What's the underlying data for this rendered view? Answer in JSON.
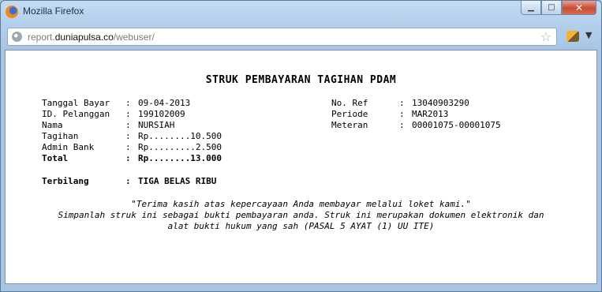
{
  "window": {
    "title": "Mozilla Firefox",
    "url_prefix": "report.",
    "url_domain": "duniapulsa.co",
    "url_path": "/webuser/"
  },
  "receipt": {
    "title": "STRUK PEMBAYARAN TAGIHAN PDAM",
    "left_fields": [
      {
        "label": "Tanggal Bayar",
        "value": "09-04-2013",
        "bold": false
      },
      {
        "label": "ID. Pelanggan",
        "value": "199102009",
        "bold": false
      },
      {
        "label": "Nama",
        "value": "NURSIAH",
        "bold": false
      },
      {
        "label": "Tagihan",
        "value": "Rp........10.500",
        "bold": false
      },
      {
        "label": "Admin Bank",
        "value": "Rp.........2.500",
        "bold": false
      },
      {
        "label": "Total",
        "value": "Rp........13.000",
        "bold": true
      }
    ],
    "right_fields": [
      {
        "label": "No. Ref",
        "value": "13040903290"
      },
      {
        "label": "Periode",
        "value": "MAR2013"
      },
      {
        "label": "Meteran",
        "value": "00001075-00001075"
      }
    ],
    "separator": ":",
    "terbilang_label": "Terbilang",
    "terbilang_value": "TIGA BELAS RIBU",
    "thanks": "\"Terima kasih atas kepercayaan Anda membayar melalui loket kami.\"",
    "notice_line1": "Simpanlah struk ini sebagai bukti pembayaran anda. Struk ini merupakan dokumen elektronik dan",
    "notice_line2": "alat bukti hukum yang sah (PASAL 5 AYAT (1) UU ITE)"
  },
  "icons": {
    "app": "firefox-logo-icon",
    "site": "globe-icon",
    "bookmark": "star-icon",
    "addon": "addon-icon",
    "menu": "chevron-down-icon",
    "minimize": "minimize-icon",
    "maximize": "maximize-icon",
    "close": "close-icon"
  }
}
